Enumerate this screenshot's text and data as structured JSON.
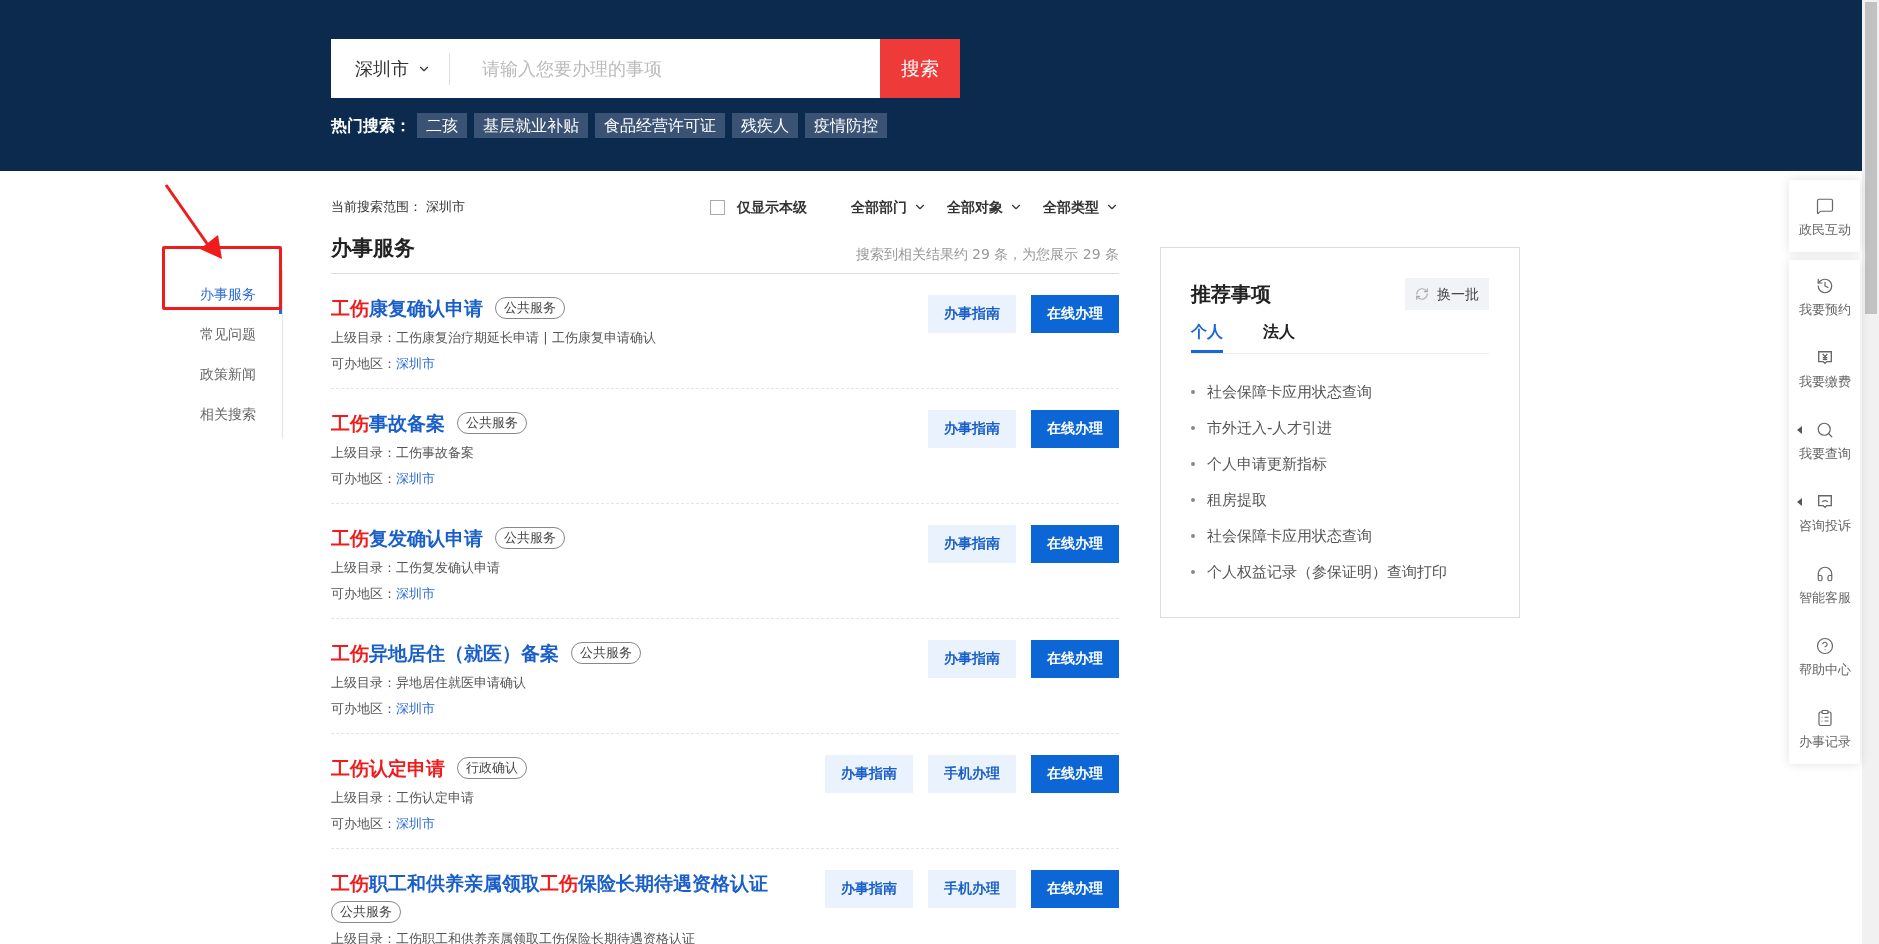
{
  "search": {
    "city": "深圳市",
    "placeholder": "请输入您要办理的事项",
    "button": "搜索"
  },
  "hot_search": {
    "label": "热门搜索：",
    "tags": [
      "二孩",
      "基层就业补贴",
      "食品经营许可证",
      "残疾人",
      "疫情防控"
    ]
  },
  "sidebar": {
    "items": [
      {
        "label": "办事服务",
        "selected": true
      },
      {
        "label": "常见问题",
        "selected": false
      },
      {
        "label": "政策新闻",
        "selected": false
      },
      {
        "label": "相关搜索",
        "selected": false
      }
    ]
  },
  "filters": {
    "scope_label": "当前搜索范围：",
    "scope_value": "深圳市",
    "only_this_level": {
      "label": "仅显示本级",
      "checked": false
    },
    "dropdowns": [
      "全部部门",
      "全部对象",
      "全部类型"
    ]
  },
  "results": {
    "title": "办事服务",
    "summary": "搜索到相关结果约 29 条，为您展示 29 条",
    "items": [
      {
        "title": [
          {
            "text": "工伤",
            "highlight": true
          },
          {
            "text": "康复确认申请",
            "highlight": false
          }
        ],
        "tag": "公共服务",
        "parent": "上级目录：工伤康复治疗期延长申请 | 工伤康复申请确认",
        "region_label": "可办地区：",
        "region": "深圳市",
        "buttons": [
          {
            "label": "办事指南",
            "kind": "guide"
          },
          {
            "label": "在线办理",
            "kind": "online"
          }
        ]
      },
      {
        "title": [
          {
            "text": "工伤",
            "highlight": true
          },
          {
            "text": "事故备案",
            "highlight": false
          }
        ],
        "tag": "公共服务",
        "parent": "上级目录：工伤事故备案",
        "region_label": "可办地区：",
        "region": "深圳市",
        "buttons": [
          {
            "label": "办事指南",
            "kind": "guide"
          },
          {
            "label": "在线办理",
            "kind": "online"
          }
        ]
      },
      {
        "title": [
          {
            "text": "工伤",
            "highlight": true
          },
          {
            "text": "复发确认申请",
            "highlight": false
          }
        ],
        "tag": "公共服务",
        "parent": "上级目录：工伤复发确认申请",
        "region_label": "可办地区：",
        "region": "深圳市",
        "buttons": [
          {
            "label": "办事指南",
            "kind": "guide"
          },
          {
            "label": "在线办理",
            "kind": "online"
          }
        ]
      },
      {
        "title": [
          {
            "text": "工伤",
            "highlight": true
          },
          {
            "text": "异地居住（就医）备案",
            "highlight": false
          }
        ],
        "tag": "公共服务",
        "parent": "上级目录：异地居住就医申请确认",
        "region_label": "可办地区：",
        "region": "深圳市",
        "buttons": [
          {
            "label": "办事指南",
            "kind": "guide"
          },
          {
            "label": "在线办理",
            "kind": "online"
          }
        ]
      },
      {
        "title": [
          {
            "text": "工伤认定申请",
            "highlight": true
          }
        ],
        "tag": "行政确认",
        "parent": "上级目录：工伤认定申请",
        "region_label": "可办地区：",
        "region": "深圳市",
        "buttons": [
          {
            "label": "办事指南",
            "kind": "guide"
          },
          {
            "label": "手机办理",
            "kind": "mobile"
          },
          {
            "label": "在线办理",
            "kind": "online"
          }
        ]
      },
      {
        "title": [
          {
            "text": "工伤",
            "highlight": true
          },
          {
            "text": "职工和供养亲属领取",
            "highlight": false
          },
          {
            "text": "工伤",
            "highlight": true
          },
          {
            "text": "保险长期待遇资格认证",
            "highlight": false
          }
        ],
        "tag": "公共服务",
        "parent": "上级目录：工伤职工和供养亲属领取工伤保险长期待遇资格认证",
        "buttons": [
          {
            "label": "办事指南",
            "kind": "guide"
          },
          {
            "label": "手机办理",
            "kind": "mobile"
          },
          {
            "label": "在线办理",
            "kind": "online"
          }
        ]
      }
    ]
  },
  "recommend": {
    "title": "推荐事项",
    "refresh": "换一批",
    "tabs": [
      {
        "label": "个人",
        "selected": true
      },
      {
        "label": "法人",
        "selected": false
      }
    ],
    "items": [
      "社会保障卡应用状态查询",
      "市外迁入-人才引进",
      "个人申请更新指标",
      "租房提取",
      "社会保障卡应用状态查询",
      "个人权益记录（参保证明）查询打印"
    ]
  },
  "side_toolbar": {
    "pinned": [
      {
        "label": "政民互动",
        "kind": "chat",
        "submenu": false
      }
    ],
    "items": [
      {
        "label": "我要预约",
        "kind": "clock",
        "submenu": false
      },
      {
        "label": "我要缴费",
        "kind": "yen",
        "submenu": false
      },
      {
        "label": "我要查询",
        "kind": "search",
        "submenu": true
      },
      {
        "label": "咨询投诉",
        "kind": "complaint",
        "submenu": true
      },
      {
        "label": "智能客服",
        "kind": "headset",
        "submenu": false
      },
      {
        "label": "帮助中心",
        "kind": "help",
        "submenu": false
      },
      {
        "label": "办事记录",
        "kind": "clipboard",
        "submenu": false
      }
    ]
  }
}
